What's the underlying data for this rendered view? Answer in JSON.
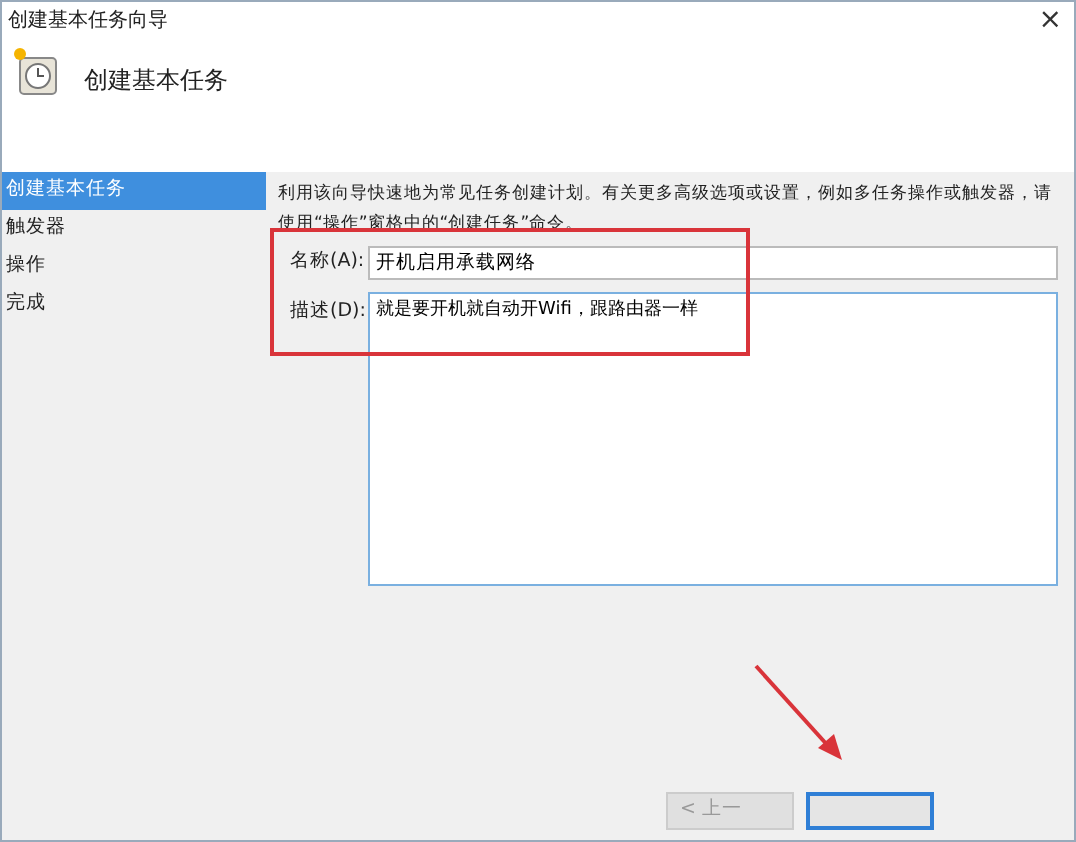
{
  "window": {
    "title": "创建基本任务向导",
    "close": "×"
  },
  "header": {
    "title": "创建基本任务"
  },
  "steps": [
    {
      "label": "创建基本任务",
      "selected": true
    },
    {
      "label": "触发器",
      "selected": false
    },
    {
      "label": "操作",
      "selected": false
    },
    {
      "label": "完成",
      "selected": false
    }
  ],
  "intro": "利用该向导快速地为常见任务创建计划。有关更多高级选项或设置，例如多任务操作或触发器，请使用“操作”窗格中的“创建任务”命令。",
  "name_field": {
    "label": "名称(A):",
    "value": "开机启用承载网络"
  },
  "description_field": {
    "label": "描述(D):",
    "value": "就是要开机就自动开Wifi，跟路由器一样"
  },
  "buttons": [
    {
      "label": "< 上一",
      "disabled": true,
      "default": false
    },
    {
      "disabled": false,
      "default": true
    }
  ]
}
